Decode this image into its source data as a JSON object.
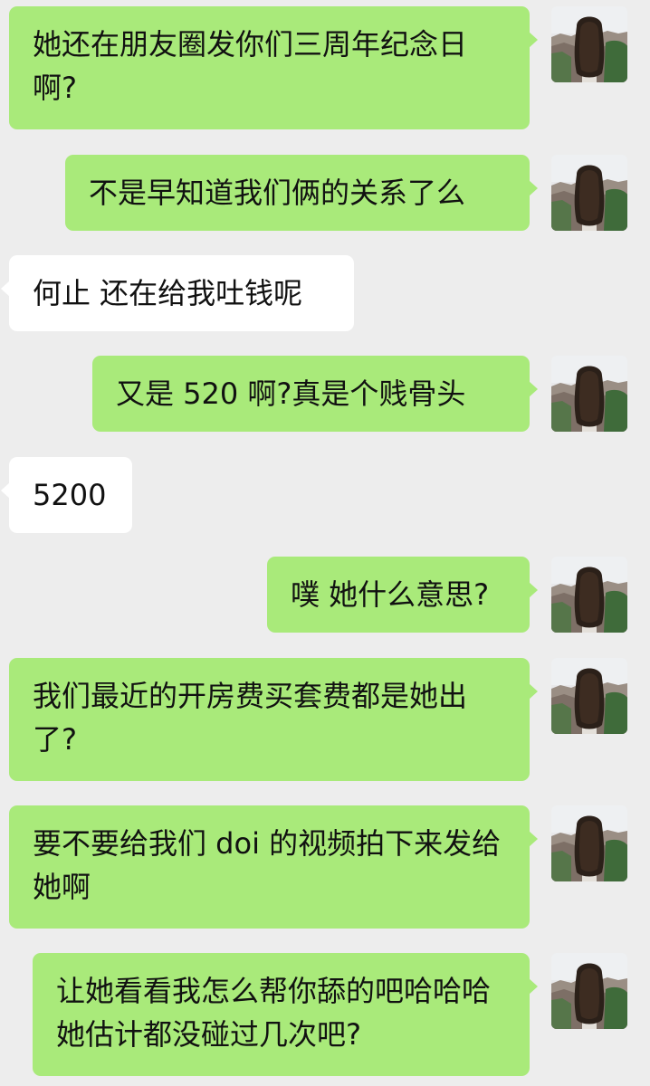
{
  "messages": [
    {
      "sender": "me",
      "text": "她还在朋友圈发你们三周年纪念日啊?"
    },
    {
      "sender": "me",
      "text": "不是早知道我们俩的关系了么"
    },
    {
      "sender": "them",
      "text": "何止 还在给我吐钱呢"
    },
    {
      "sender": "me",
      "text": "又是 520 啊?真是个贱骨头"
    },
    {
      "sender": "them",
      "text": "5200"
    },
    {
      "sender": "me",
      "text": "噗 她什么意思?"
    },
    {
      "sender": "me",
      "text": "我们最近的开房费买套费都是她出了?"
    },
    {
      "sender": "me",
      "text": "要不要给我们 doi 的视频拍下来发给她啊"
    },
    {
      "sender": "me",
      "text": "让她看看我怎么帮你舔的吧哈哈哈 她估计都没碰过几次吧?"
    }
  ],
  "avatar": {
    "icon": "long-hair-girl-landscape-avatar-icon"
  },
  "colors": {
    "background": "#ededed",
    "outgoing_bubble": "#a9ea7a",
    "incoming_bubble": "#ffffff",
    "text": "#111111"
  }
}
